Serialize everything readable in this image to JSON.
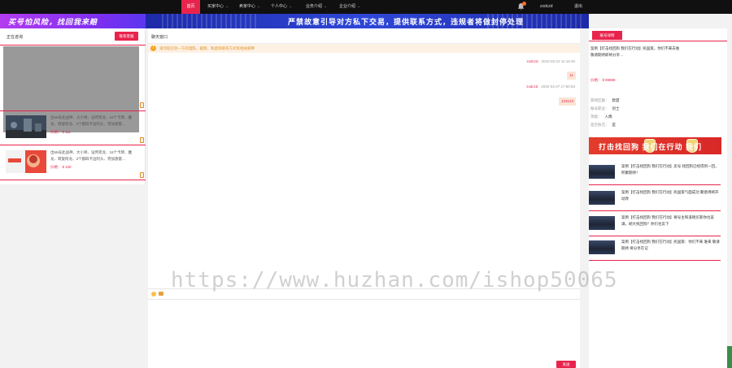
{
  "nav": {
    "items": [
      "首页",
      "买家中心",
      "卖家中心",
      "个人中心",
      "业务介绍",
      "企业介绍"
    ],
    "username": "zxdczd",
    "logout": "退出"
  },
  "banners": {
    "left": "买号怕风险，找回我来赔",
    "main": "严禁故意引导对方私下交易，提供联系方式，违规者将做封停处理"
  },
  "left_panel": {
    "title": "正在咨询",
    "button": "联系客服",
    "items": [
      {
        "desc": "出65号此战神、大小师、设传宛龙、16个卡牌、魔龙、转旋阿龙、3个都四卡边阿头、宵加香雷…",
        "price": "价格：￥111"
      },
      {
        "desc": "出65号此战神、大小师、设传宛龙、16个卡牌、魔龙、转旋阿龙、3个都四卡边阿头、宵加香雷…",
        "price": "价格：￥100"
      }
    ]
  },
  "chat": {
    "title": "聊天窗口",
    "notice": "请勿轻信另一方的理陈、截图、和虚则联系方式等相关解释",
    "messages": [
      {
        "name": "zxdczd",
        "time": "2022-03-22 11:16:49",
        "text": "11"
      },
      {
        "name": "zxdczd",
        "time": "2022-04-27 17:50:53",
        "text": "123123"
      }
    ],
    "send": "发送",
    "watermark": "https://www.huzhan.com/ishop50065"
  },
  "right_panel": {
    "button": "账号详情",
    "desc": "案例【打击找回狗 我们在行动】民国第，你们不来去谁 敬请期待即将分享…",
    "price": "价格：￥99999",
    "rows": [
      {
        "label": "游戏区服：",
        "value": "默盟"
      },
      {
        "label": "账号职业：",
        "value": "剑士"
      },
      {
        "label": "等级：",
        "value": "人偶"
      },
      {
        "label": "是否防沉：",
        "value": "是"
      }
    ],
    "ad": "打击找回狗  我们在行动  我们",
    "news": [
      "案例【打击找回狗 我们在行动】卖号 找回狗已经得到一回，所聚期待！",
      "案例【打击找回狗 我们在行动】民国第气面成功 聚意佛将开动改",
      "案例【打击找回狗 我们在行动】要号主和道德买家你也美满，刷大找回狗？你们也卖下",
      "案例【打击找回狗 我们在行动】民国第：你们不来 谁来 敬请期待 将分享在记"
    ]
  }
}
